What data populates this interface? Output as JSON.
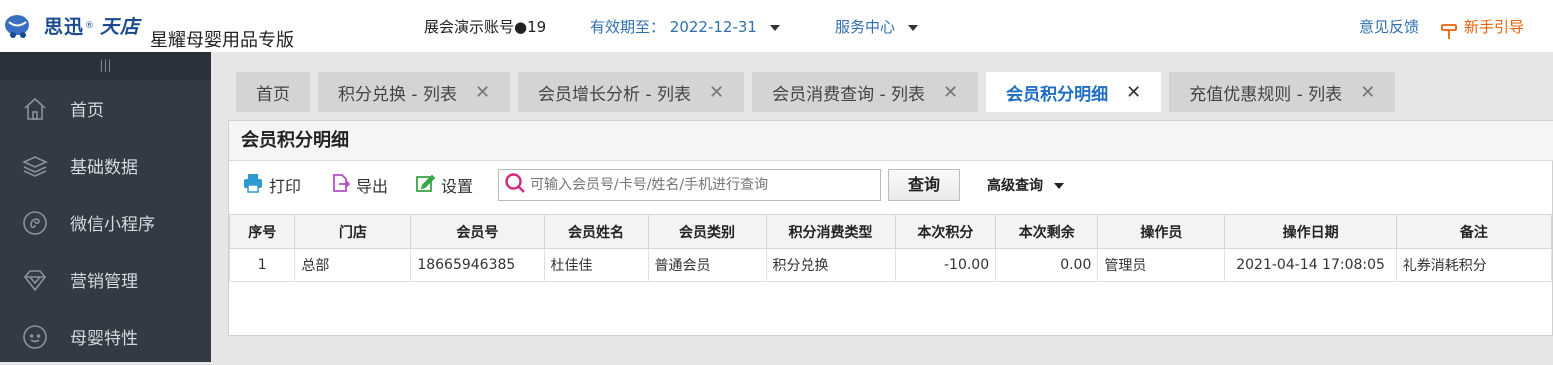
{
  "header": {
    "logo_text": "思迅",
    "logo_text2": "天店",
    "logo_reg": "®",
    "store_name": "星耀母婴用品专版",
    "account": "展会演示账号●19",
    "expire_label": "有效期至：",
    "expire_date": "2022-12-31",
    "service_center": "服务中心",
    "feedback": "意见反馈",
    "guide": "新手引导"
  },
  "sidebar": {
    "toggle_glyph": "|||",
    "items": [
      {
        "label": "首页",
        "icon": "home-icon"
      },
      {
        "label": "基础数据",
        "icon": "layers-icon"
      },
      {
        "label": "微信小程序",
        "icon": "miniprogram-icon"
      },
      {
        "label": "营销管理",
        "icon": "diamond-icon"
      },
      {
        "label": "母婴特性",
        "icon": "baby-icon"
      }
    ]
  },
  "tabs": [
    {
      "label": "首页",
      "closable": false
    },
    {
      "label": "积分兑换 - 列表",
      "closable": true
    },
    {
      "label": "会员增长分析 - 列表",
      "closable": true
    },
    {
      "label": "会员消费查询 - 列表",
      "closable": true
    },
    {
      "label": "会员积分明细",
      "closable": true,
      "active": true
    },
    {
      "label": "充值优惠规则 - 列表",
      "closable": true
    }
  ],
  "close_glyph": "✕",
  "panel": {
    "title": "会员积分明细",
    "print_label": "打印",
    "export_label": "导出",
    "settings_label": "设置",
    "search_placeholder": "可输入会员号/卡号/姓名/手机进行查询",
    "query_label": "查询",
    "advanced_label": "高级查询"
  },
  "table": {
    "columns": [
      "序号",
      "门店",
      "会员号",
      "会员姓名",
      "会员类别",
      "积分消费类型",
      "本次积分",
      "本次剩余",
      "操作员",
      "操作日期",
      "备注"
    ],
    "rows": [
      [
        "1",
        "总部",
        "18665946385",
        "杜佳佳",
        "普通会员",
        "积分兑换",
        "-10.00",
        "0.00",
        "管理员",
        "2021-04-14 17:08:05",
        "礼券消耗积分"
      ]
    ]
  },
  "colors": {
    "accent": "#1f6dc4",
    "guide": "#e8620a",
    "sidebar_bg": "#333a44"
  }
}
